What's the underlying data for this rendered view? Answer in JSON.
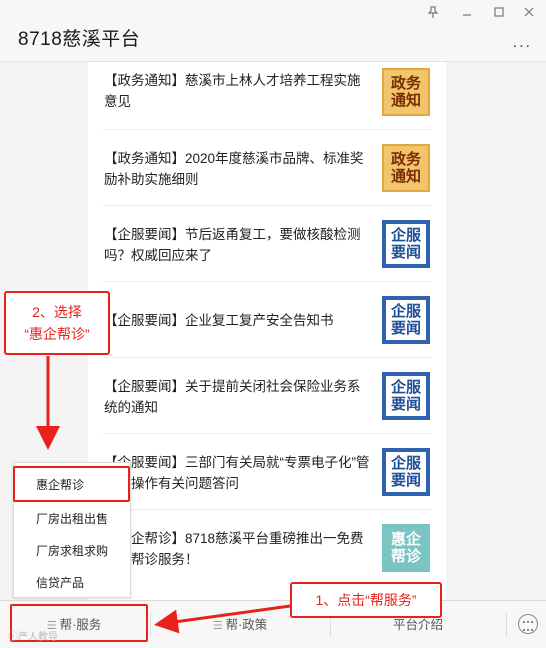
{
  "window": {
    "title": "8718慈溪平台",
    "pin_icon": "pin-icon",
    "minimize_icon": "minimize-icon",
    "maximize_icon": "maximize-icon",
    "close_icon": "close-icon",
    "more_label": "..."
  },
  "articles": [
    {
      "text": "【政务通知】慈溪市上林人才培养工程实施意见",
      "thumb": [
        "政务",
        "通知"
      ]
    },
    {
      "text": "【政务通知】2020年度慈溪市品牌、标准奖励补助实施细则",
      "thumb": [
        "政务",
        "通知"
      ]
    },
    {
      "text": "【企服要闻】节后返甬复工，要做核酸检测吗？权威回应来了",
      "thumb": [
        "企服",
        "要闻"
      ]
    },
    {
      "text": "【企服要闻】企业复工复产安全告知书",
      "thumb": [
        "企服",
        "要闻"
      ]
    },
    {
      "text": "【企服要闻】关于提前关闭社会保险业务系统的通知",
      "thumb": [
        "企服",
        "要闻"
      ]
    },
    {
      "text": "【企服要闻】三部门有关局就“专票电子化”管理与操作有关问题答问",
      "thumb": [
        "企服",
        "要闻"
      ]
    },
    {
      "text": "【惠企帮诊】8718慈溪平台重磅推出一免费惠企帮诊服务！",
      "thumb": [
        "惠企",
        "帮诊"
      ]
    }
  ],
  "popup_menu": {
    "items": [
      "惠企帮诊",
      "厂房出租出售",
      "厂房求租求购",
      "信贷产品"
    ]
  },
  "menubar": {
    "items": [
      "帮·服务",
      "帮·政策",
      "平台介绍"
    ],
    "menu_icon": "hamburger-icon",
    "keyboard_icon": "keyboard-icon"
  },
  "annotations": {
    "step1": "1、点击“帮服务”",
    "step2_line1": "2、选择",
    "step2_line2": "“惠企帮诊”"
  },
  "colors": {
    "annotation_red": "#e8221b",
    "gov_thumb_bg": "#f0c56b",
    "ent_thumb_border": "#2f63b0",
    "hui_thumb_bg": "#7bc4c4"
  },
  "watermark": "ⓘ严人教导"
}
